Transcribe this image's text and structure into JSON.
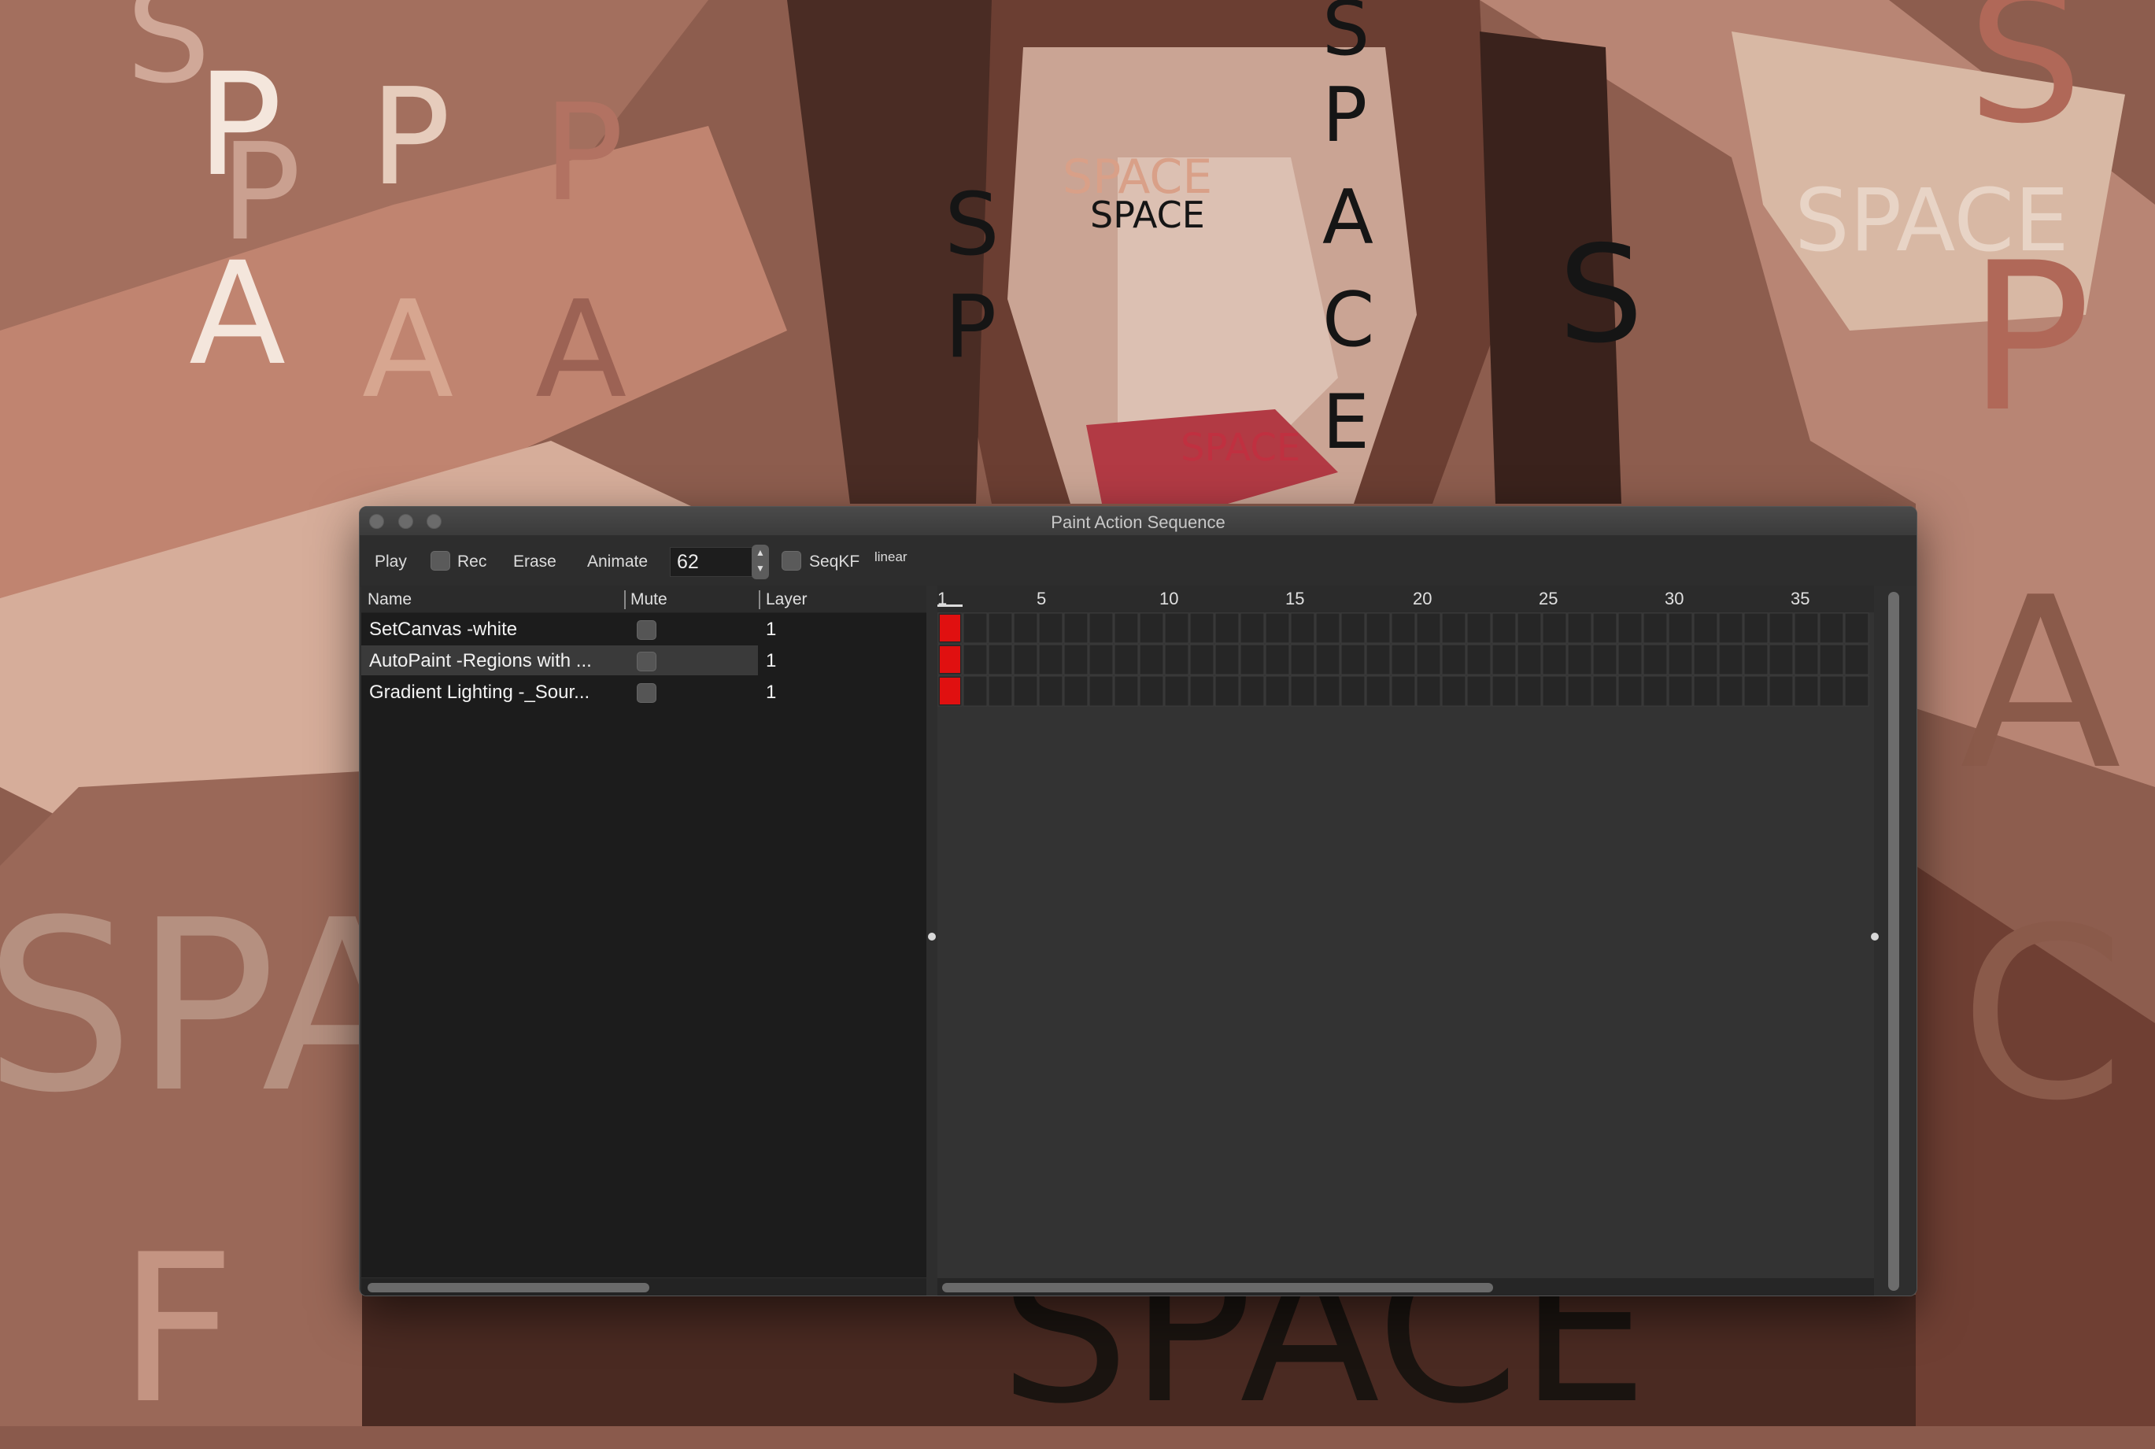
{
  "background": {
    "words": [
      {
        "text": "S",
        "color": "#d0a898"
      },
      {
        "text": "P",
        "color": "#f4e6dc"
      },
      {
        "text": "P",
        "color": "#caa090"
      },
      {
        "text": "P",
        "color": "#e6ccbc"
      },
      {
        "text": "P",
        "color": "#b27262"
      },
      {
        "text": "A",
        "color": "#f4e6dc"
      },
      {
        "text": "A",
        "color": "#d7a690"
      },
      {
        "text": "A",
        "color": "#9c6254"
      },
      {
        "text": "SPACE",
        "color": "#d9a088"
      },
      {
        "text": "SPACE",
        "color": "#e8d4c6"
      },
      {
        "text": "S",
        "color": "#b06858"
      },
      {
        "text": "P",
        "color": "#b06858"
      },
      {
        "text": "SPA",
        "color": "#b59080"
      },
      {
        "text": "F",
        "color": "#c49482"
      },
      {
        "text": "SPACE",
        "color": "#1a1410"
      },
      {
        "text": "S",
        "color": "#151515"
      },
      {
        "text": "P",
        "color": "#151515"
      },
      {
        "text": "A",
        "color": "#151515"
      },
      {
        "text": "C",
        "color": "#151515"
      },
      {
        "text": "E",
        "color": "#151515"
      },
      {
        "text": "SPACE",
        "color": "#151515"
      },
      {
        "text": "SPACE",
        "color": "#c03040"
      },
      {
        "text": "S",
        "color": "#151515"
      },
      {
        "text": "P",
        "color": "#151515"
      },
      {
        "text": "S",
        "color": "#151515"
      },
      {
        "text": "A",
        "color": "#8a5a4a"
      },
      {
        "text": "C",
        "color": "#8a5a4a"
      }
    ]
  },
  "window": {
    "title": "Paint Action Sequence",
    "toolbar": {
      "play": "Play",
      "rec": "Rec",
      "erase": "Erase",
      "animate": "Animate",
      "animate_value": "62",
      "seqkf": "SeqKF",
      "interpolation": "linear"
    },
    "columns": {
      "name": "Name",
      "mute": "Mute",
      "layer": "Layer"
    },
    "rows": [
      {
        "name": "SetCanvas -white",
        "layer": "1",
        "selected": false,
        "muted": false
      },
      {
        "name": "AutoPaint -Regions with ...",
        "layer": "1",
        "selected": true,
        "muted": false
      },
      {
        "name": "Gradient Lighting -_Sour...",
        "layer": "1",
        "selected": false,
        "muted": false
      }
    ],
    "timeline": {
      "tick_labels": [
        "1",
        "5",
        "10",
        "15",
        "20",
        "25",
        "30",
        "35"
      ],
      "keyframe_color": "#e01010",
      "keyframes": [
        {
          "row": 0,
          "frame": 1
        },
        {
          "row": 1,
          "frame": 1
        },
        {
          "row": 2,
          "frame": 1
        }
      ]
    }
  }
}
